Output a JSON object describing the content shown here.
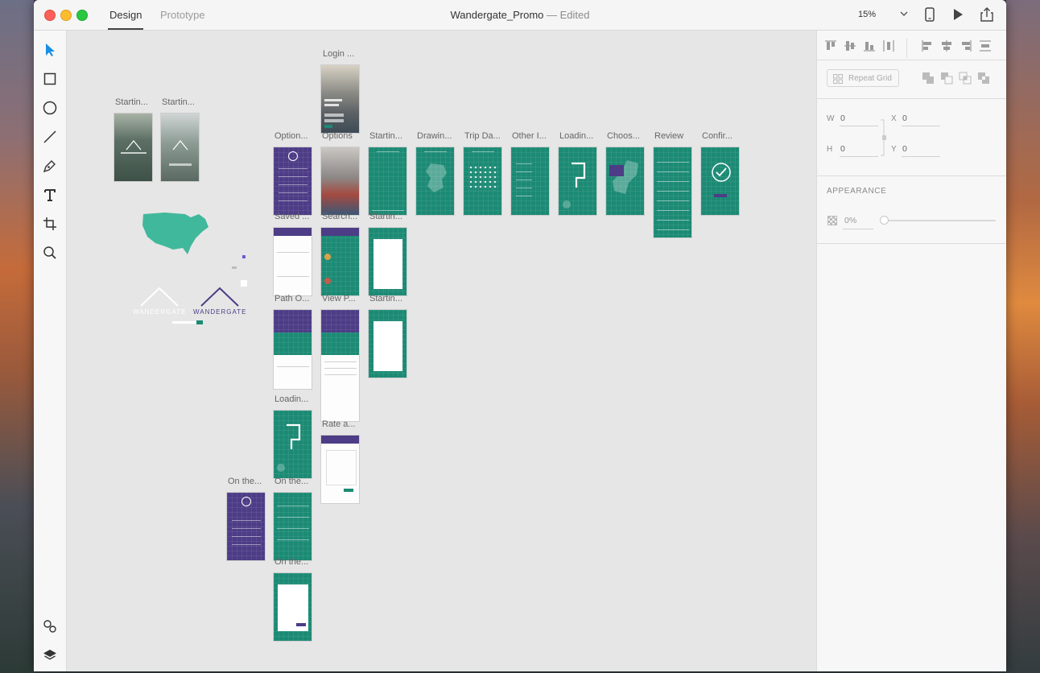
{
  "window": {
    "title": "Wandergate_Promo",
    "status": "— Edited",
    "tabs": [
      {
        "label": "Design",
        "active": true
      },
      {
        "label": "Prototype",
        "active": false
      }
    ],
    "zoom": "15%"
  },
  "toolbar": {
    "tools": [
      {
        "name": "select-icon",
        "active": true
      },
      {
        "name": "rectangle-icon"
      },
      {
        "name": "ellipse-icon"
      },
      {
        "name": "line-icon"
      },
      {
        "name": "pen-icon"
      },
      {
        "name": "text-icon"
      },
      {
        "name": "artboard-icon"
      },
      {
        "name": "zoom-icon"
      }
    ],
    "bottom": [
      {
        "name": "symbols-icon"
      },
      {
        "name": "layers-icon"
      }
    ]
  },
  "panel": {
    "repeat_grid": "Repeat Grid",
    "w_label": "W",
    "w_value": "0",
    "h_label": "H",
    "h_value": "0",
    "x_label": "X",
    "x_value": "0",
    "y_label": "Y",
    "y_value": "0",
    "appearance_heading": "APPEARANCE",
    "opacity": "0%"
  },
  "canvas": {
    "artboards": [
      {
        "label": "Login ...",
        "style": "ph3"
      },
      {
        "label": "Startin...",
        "style": "ph"
      },
      {
        "label": "Startin...",
        "style": "ph2"
      },
      {
        "label": "Option...",
        "style": "p"
      },
      {
        "label": "Options",
        "style": "ph4"
      },
      {
        "label": "Startin...",
        "style": "g"
      },
      {
        "label": "Drawin...",
        "style": "g"
      },
      {
        "label": "Trip Da...",
        "style": "g"
      },
      {
        "label": "Other I...",
        "style": "g"
      },
      {
        "label": "Loadin...",
        "style": "g"
      },
      {
        "label": "Choos...",
        "style": "g"
      },
      {
        "label": "Review",
        "style": "g"
      },
      {
        "label": "Confir...",
        "style": "g"
      },
      {
        "label": "Saved ...",
        "style": "w"
      },
      {
        "label": "Search...",
        "style": "g"
      },
      {
        "label": "Startin...",
        "style": "g"
      },
      {
        "label": "Path O...",
        "style": "w"
      },
      {
        "label": "View P...",
        "style": "w"
      },
      {
        "label": "Startin...",
        "style": "g"
      },
      {
        "label": "Loadin...",
        "style": "g"
      },
      {
        "label": "Rate a...",
        "style": "w"
      },
      {
        "label": "On the...",
        "style": "p"
      },
      {
        "label": "On the...",
        "style": "g"
      },
      {
        "label": "On the...",
        "style": "g"
      }
    ],
    "logos": [
      "WANDERGATE",
      "WANDERGATE"
    ],
    "colors": {
      "green": "#1c8a74",
      "purple": "#4d3c86",
      "accent": "#1a8fe3"
    }
  }
}
